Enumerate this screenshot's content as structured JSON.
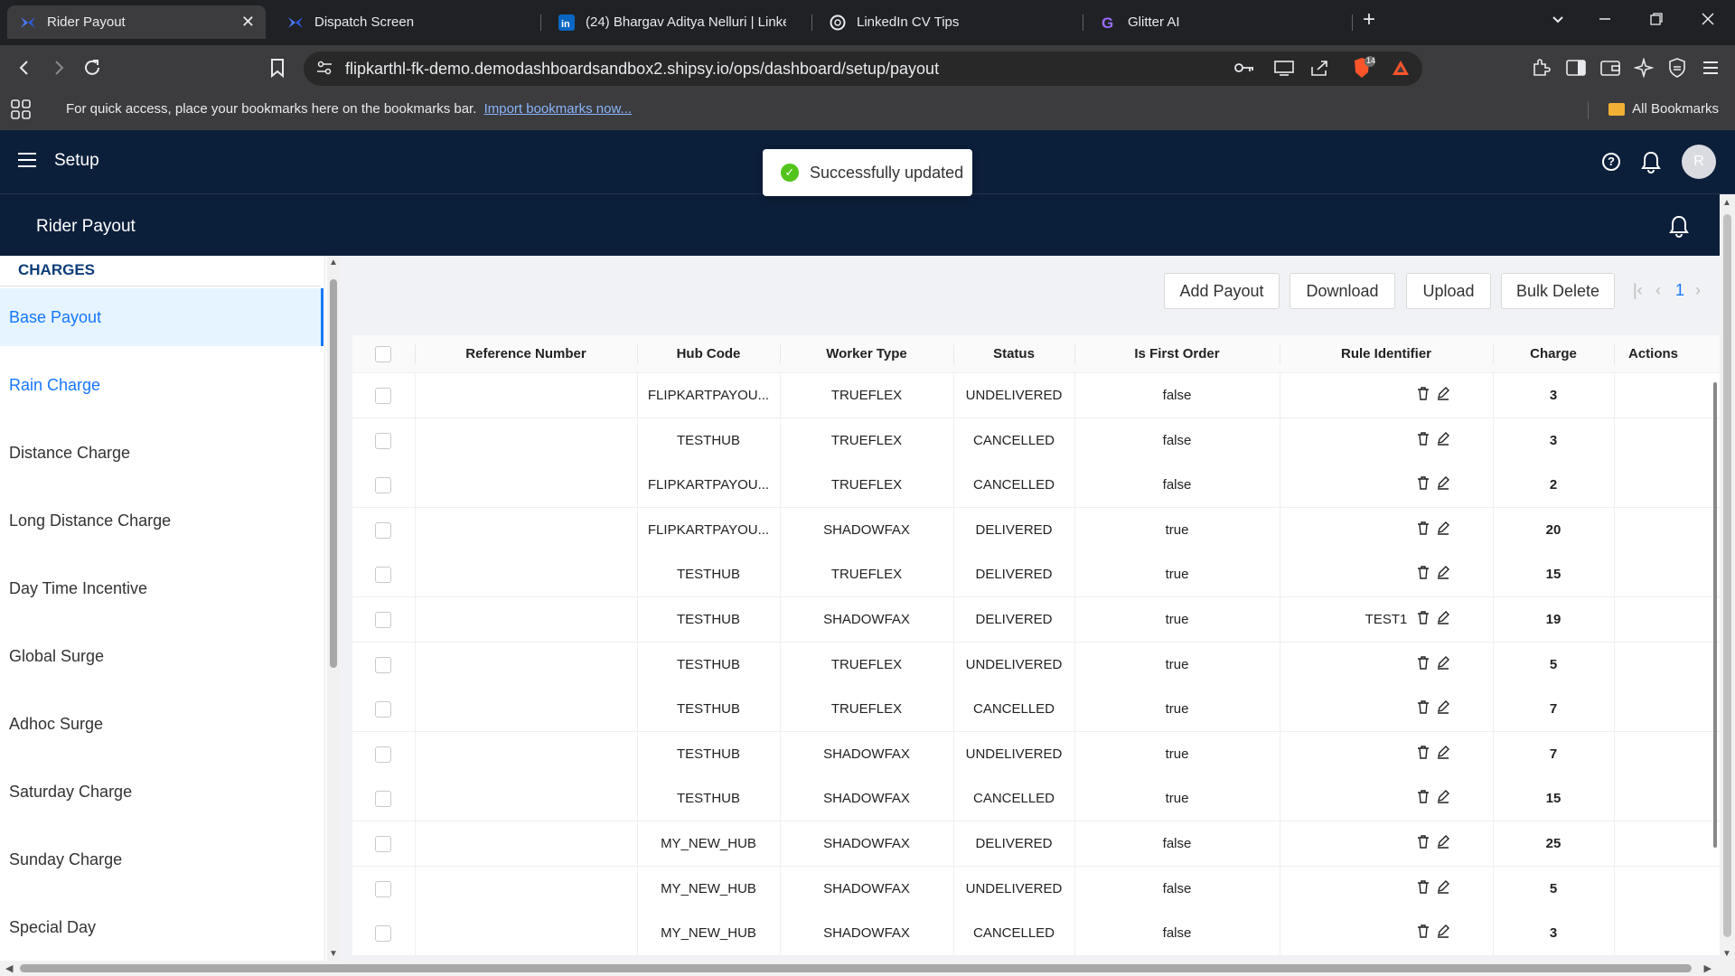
{
  "browser": {
    "tabs": [
      {
        "title": "Rider Payout",
        "icon": "shipsy-icon",
        "active": true
      },
      {
        "title": "Dispatch Screen",
        "icon": "shipsy-icon",
        "active": false
      },
      {
        "title": "(24) Bhargav Aditya Nelluri | LinkedI",
        "icon": "linkedin-icon",
        "active": false
      },
      {
        "title": "LinkedIn CV Tips",
        "icon": "openai-icon",
        "active": false
      },
      {
        "title": "Glitter AI",
        "icon": "glitter-icon",
        "active": false
      }
    ],
    "new_tab": "+",
    "url": "flipkarthl-fk-demo.demodashboardsandbox2.shipsy.io/ops/dashboard/setup/payout",
    "brave_badge": "14",
    "bookmarks_message": "For quick access, place your bookmarks here on the bookmarks bar.",
    "bookmarks_import": "Import bookmarks now...",
    "all_bookmarks": "All Bookmarks"
  },
  "app": {
    "title": "Setup",
    "avatar": "R",
    "help": "?"
  },
  "toast": {
    "message": "Successfully updated",
    "color": "#52c41a"
  },
  "page": {
    "title": "Rider Payout"
  },
  "sidebar": {
    "heading": "CHARGES",
    "items": [
      {
        "label": "Base Payout",
        "state": "active"
      },
      {
        "label": "Rain Charge",
        "state": "link"
      },
      {
        "label": "Distance Charge",
        "state": ""
      },
      {
        "label": "Long Distance Charge",
        "state": ""
      },
      {
        "label": "Day Time Incentive",
        "state": ""
      },
      {
        "label": "Global Surge",
        "state": ""
      },
      {
        "label": "Adhoc Surge",
        "state": ""
      },
      {
        "label": "Saturday Charge",
        "state": ""
      },
      {
        "label": "Sunday Charge",
        "state": ""
      },
      {
        "label": "Special Day",
        "state": ""
      }
    ]
  },
  "actions": {
    "add_payout": "Add Payout",
    "download": "Download",
    "upload": "Upload",
    "bulk_delete": "Bulk Delete",
    "page": "1"
  },
  "table": {
    "columns": [
      "Reference Number",
      "Hub Code",
      "Worker Type",
      "Status",
      "Is First Order",
      "Rule Identifier",
      "Charge",
      "Actions"
    ],
    "rows": [
      {
        "ref": "",
        "hub": "FLIPKARTPAYOU...",
        "worker": "TRUEFLEX",
        "status": "UNDELIVERED",
        "first": "false",
        "rule": "",
        "charge": "3"
      },
      {
        "ref": "",
        "hub": "TESTHUB",
        "worker": "TRUEFLEX",
        "status": "CANCELLED",
        "first": "false",
        "rule": "",
        "charge": "3"
      },
      {
        "ref": "",
        "hub": "FLIPKARTPAYOU...",
        "worker": "TRUEFLEX",
        "status": "CANCELLED",
        "first": "false",
        "rule": "",
        "charge": "2"
      },
      {
        "ref": "",
        "hub": "FLIPKARTPAYOU...",
        "worker": "SHADOWFAX",
        "status": "DELIVERED",
        "first": "true",
        "rule": "",
        "charge": "20"
      },
      {
        "ref": "",
        "hub": "TESTHUB",
        "worker": "TRUEFLEX",
        "status": "DELIVERED",
        "first": "true",
        "rule": "",
        "charge": "15"
      },
      {
        "ref": "",
        "hub": "TESTHUB",
        "worker": "SHADOWFAX",
        "status": "DELIVERED",
        "first": "true",
        "rule": "TEST1",
        "charge": "19"
      },
      {
        "ref": "",
        "hub": "TESTHUB",
        "worker": "TRUEFLEX",
        "status": "UNDELIVERED",
        "first": "true",
        "rule": "",
        "charge": "5"
      },
      {
        "ref": "",
        "hub": "TESTHUB",
        "worker": "TRUEFLEX",
        "status": "CANCELLED",
        "first": "true",
        "rule": "",
        "charge": "7"
      },
      {
        "ref": "",
        "hub": "TESTHUB",
        "worker": "SHADOWFAX",
        "status": "UNDELIVERED",
        "first": "true",
        "rule": "",
        "charge": "7"
      },
      {
        "ref": "",
        "hub": "TESTHUB",
        "worker": "SHADOWFAX",
        "status": "CANCELLED",
        "first": "true",
        "rule": "",
        "charge": "15"
      },
      {
        "ref": "",
        "hub": "MY_NEW_HUB",
        "worker": "SHADOWFAX",
        "status": "DELIVERED",
        "first": "false",
        "rule": "",
        "charge": "25"
      },
      {
        "ref": "",
        "hub": "MY_NEW_HUB",
        "worker": "SHADOWFAX",
        "status": "UNDELIVERED",
        "first": "false",
        "rule": "",
        "charge": "5"
      },
      {
        "ref": "",
        "hub": "MY_NEW_HUB",
        "worker": "SHADOWFAX",
        "status": "CANCELLED",
        "first": "false",
        "rule": "",
        "charge": "3"
      }
    ]
  },
  "colors": {
    "header_bg": "#0c1f3a",
    "accent": "#1677ff",
    "active_bg": "#e6f4ff"
  }
}
